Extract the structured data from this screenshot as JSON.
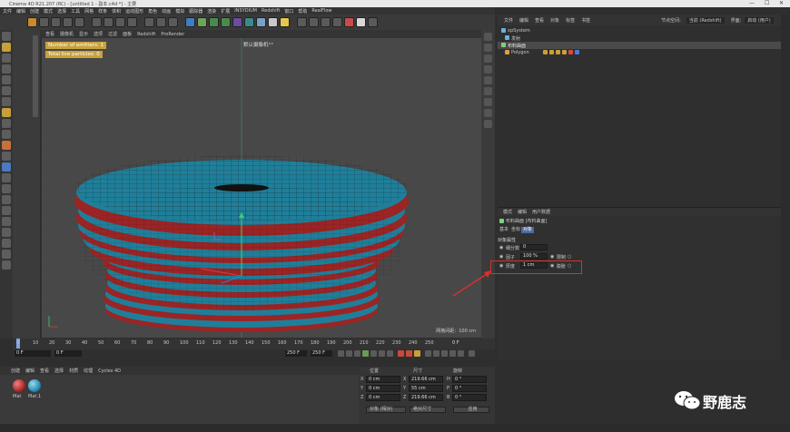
{
  "window": {
    "title": "Cinema 4D R21.207 (RC) - [untitled 1 - 副本.c4d *] - 主要",
    "controls": [
      "—",
      "☐",
      "✕"
    ]
  },
  "menubar": [
    "文件",
    "编辑",
    "创建",
    "模式",
    "选择",
    "工具",
    "网格",
    "样条",
    "体积",
    "运动图形",
    "角色",
    "动画",
    "模拟",
    "跟踪器",
    "渲染",
    "扩展",
    "INSYDIUM",
    "Redshift",
    "窗口",
    "帮助",
    "RealFlow"
  ],
  "viewport_menu": [
    "查看",
    "摄像机",
    "显示",
    "选项",
    "过滤",
    "面板",
    "Redshift",
    "ProRender"
  ],
  "viewport": {
    "camera": "默认摄像机°°",
    "hud_emitters": "Number of emitters: 1",
    "hud_particles": "Total live particles: 0",
    "grid_spacing": "网格间距：100 cm"
  },
  "timeline": {
    "ticks": [
      "0",
      "10",
      "20",
      "30",
      "40",
      "50",
      "60",
      "70",
      "80",
      "90",
      "100",
      "110",
      "120",
      "130",
      "140",
      "150",
      "160",
      "170",
      "180",
      "190",
      "200",
      "210",
      "220",
      "230",
      "240",
      "250"
    ],
    "current_frame": "0 F",
    "start": "0 F",
    "end": "250 F",
    "end2": "250 F",
    "fps_field": "0 F"
  },
  "material_panel": {
    "menu": [
      "创建",
      "编辑",
      "查看",
      "选择",
      "材质",
      "纹理",
      "Cycles 4D"
    ],
    "materials": [
      {
        "label": "Mat",
        "color": "#b02a2a"
      },
      {
        "label": "Mat.1",
        "color": "#2a8fb5"
      }
    ]
  },
  "coordinates": {
    "headers": [
      "位置",
      "尺寸",
      "旋转"
    ],
    "rows": [
      {
        "axis": "X",
        "pos": "0 cm",
        "size": "219.66 cm",
        "rot_label": "H",
        "rot": "0 °"
      },
      {
        "axis": "Y",
        "pos": "0 cm",
        "size": "55 cm",
        "rot_label": "P",
        "rot": "0 °"
      },
      {
        "axis": "Z",
        "pos": "0 cm",
        "size": "219.66 cm",
        "rot_label": "B",
        "rot": "0 °"
      }
    ],
    "mode": "对象 (相对)",
    "size_mode": "绝对尺寸",
    "apply": "应用"
  },
  "object_manager": {
    "menu": [
      "文件",
      "编辑",
      "查看",
      "对象",
      "标签",
      "书签"
    ],
    "node_label": "节点空间:",
    "node_value": "当前 (Redshift)",
    "layout_label": "界面:",
    "layout_value": "启动 (用户)",
    "objects": [
      {
        "name": "xpSystem",
        "indent": 0,
        "color": "#6ab0e0"
      },
      {
        "name": "发射",
        "indent": 1,
        "color": "#6ab0e0"
      },
      {
        "name": "布料曲面",
        "indent": 0,
        "color": "#7ed07e"
      },
      {
        "name": "Polygon",
        "indent": 1,
        "color": "#e0a040"
      }
    ]
  },
  "attributes": {
    "menu": [
      "模式",
      "编辑",
      "用户数据"
    ],
    "title": "布料曲面 [布料曲面]",
    "tabs": [
      "基本",
      "坐标",
      "对象"
    ],
    "section": "对象属性",
    "subdiv_label": "细分数",
    "subdiv_value": "0",
    "factor_label": "因子",
    "factor_value": "100 %",
    "limit_label": "限制",
    "thickness_label": "厚度",
    "thickness_value": "1 cm",
    "expand_label": "膨胀"
  },
  "watermark": {
    "text": "野鹿志"
  }
}
